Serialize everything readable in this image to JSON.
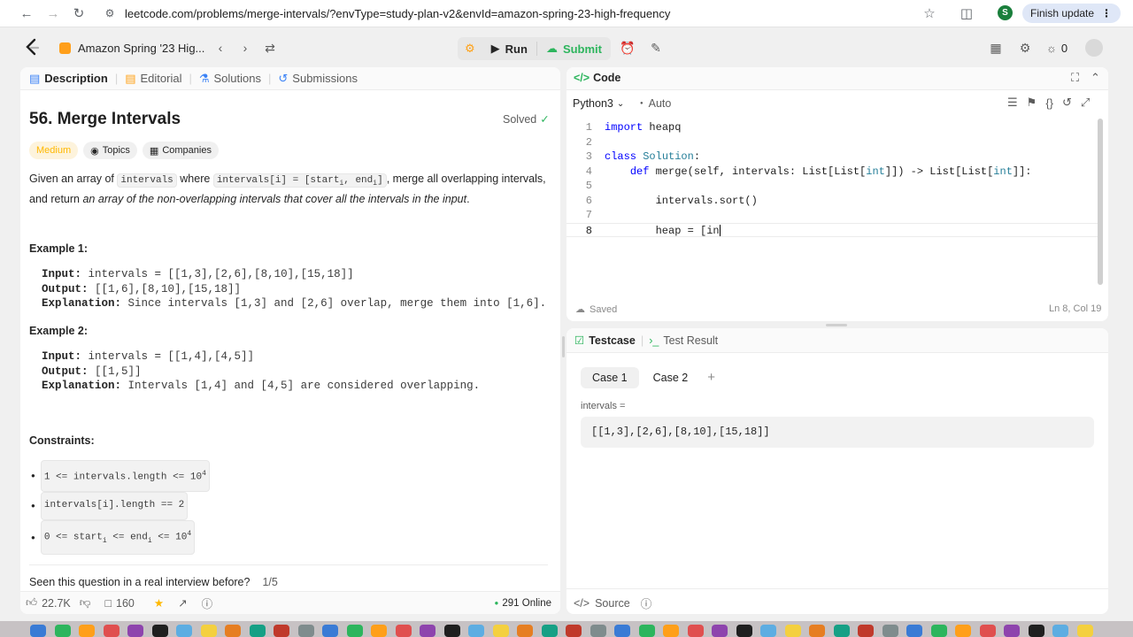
{
  "browser": {
    "url": "leetcode.com/problems/merge-intervals/?envType=study-plan-v2&envId=amazon-spring-23-high-frequency",
    "profile_initial": "S",
    "finish_update": "Finish update"
  },
  "nav": {
    "study_plan": "Amazon Spring '23 Hig...",
    "run": "Run",
    "submit": "Submit",
    "streak_count": "0",
    "colors": {
      "submit": "#2db55d",
      "accent": "#ffa116"
    }
  },
  "left_tabs": [
    "Description",
    "Editorial",
    "Solutions",
    "Submissions"
  ],
  "problem": {
    "title": "56. Merge Intervals",
    "status": "Solved",
    "difficulty": "Medium",
    "topics": "Topics",
    "companies": "Companies",
    "desc_1": "Given an array of",
    "desc_code_1": "intervals",
    "desc_2": "where",
    "desc_code_2a": "intervals[i] = [start",
    "desc_sub_i": "i",
    "desc_code_2b": ", end",
    "desc_code_2c": "]",
    "desc_3": ", merge all overlapping intervals, and",
    "desc_4": "return",
    "desc_em": "an array of the non-overlapping intervals that cover all the intervals in the input",
    "desc_5": ".",
    "example1_title": "Example 1:",
    "example1_input_label": "Input:",
    "example1_input": "intervals = [[1,3],[2,6],[8,10],[15,18]]",
    "example1_output_label": "Output:",
    "example1_output": "[[1,6],[8,10],[15,18]]",
    "example1_expl_label": "Explanation:",
    "example1_expl": "Since intervals [1,3] and [2,6] overlap, merge them into [1,6].",
    "example2_title": "Example 2:",
    "example2_input_label": "Input:",
    "example2_input": "intervals = [[1,4],[4,5]]",
    "example2_output_label": "Output:",
    "example2_output": "[[1,5]]",
    "example2_expl_label": "Explanation:",
    "example2_expl": "Intervals [1,4] and [4,5] are considered overlapping.",
    "constraints_title": "Constraints:",
    "c1a": "1 <= intervals.length <= 10",
    "c1sup": "4",
    "c2": "intervals[i].length == 2",
    "c3a": "0 <= start",
    "c3sub1": "i",
    "c3b": " <= end",
    "c3sub2": "i",
    "c3c": " <= 10",
    "c3sup": "4",
    "interview_q": "Seen this question in a real interview before?",
    "interview_page": "1/5",
    "likes": "22.7K",
    "comments": "160",
    "online": "291 Online"
  },
  "code": {
    "title": "Code",
    "language": "Python3",
    "auto": "Auto",
    "saved": "Saved",
    "cursor_pos": "Ln 8, Col 19",
    "lines": [
      {
        "n": "1",
        "t1": "import",
        "t2": " heapq"
      },
      {
        "n": "2"
      },
      {
        "n": "3",
        "t1": "class",
        "t2": " ",
        "t3": "Solution",
        "t4": ":"
      },
      {
        "n": "4",
        "pre": "    ",
        "t1": "def",
        "t2": " merge(self, intervals: List[List[",
        "t3": "int",
        "t4": "]]) -> List[List[",
        "t5": "int",
        "t6": "]]:"
      },
      {
        "n": "5"
      },
      {
        "n": "6",
        "pre": "        ",
        "t2": "intervals.sort()"
      },
      {
        "n": "7"
      },
      {
        "n": "8",
        "pre": "        ",
        "t2": "heap = [in"
      }
    ]
  },
  "testcase": {
    "tab_testcase": "Testcase",
    "tab_result": "Test Result",
    "case1": "Case 1",
    "case2": "Case 2",
    "add": "+",
    "var_label": "intervals =",
    "value": "[[1,3],[2,6],[8,10],[15,18]]",
    "source": "Source"
  }
}
